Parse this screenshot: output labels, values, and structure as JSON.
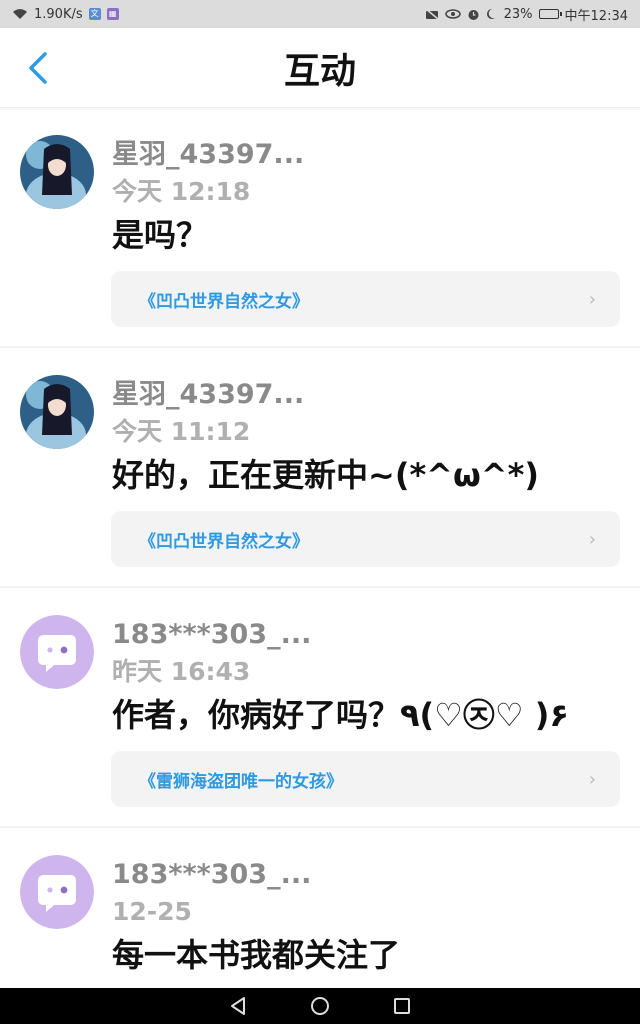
{
  "status_bar": {
    "speed": "1.90K/s",
    "battery": "23%",
    "battery_level": 0.23,
    "time": "中午12:34",
    "icons": [
      "wifi-icon",
      "translate-icon",
      "app-icon",
      "no-camera-icon",
      "eye-icon",
      "alarm-icon",
      "moon-icon",
      "battery-icon"
    ]
  },
  "header": {
    "title": "互动",
    "back_icon": "chevron-left-icon",
    "accent": "#2e9ae0"
  },
  "items": [
    {
      "username": "星羽_43397...",
      "time": "今天 12:18",
      "message": "是吗？",
      "book": "《凹凸世界自然之女》",
      "avatar": "anime-character-avatar"
    },
    {
      "username": "星羽_43397...",
      "time": "今天 11:12",
      "message": "好的，正在更新中~(*^ω^*)",
      "book": "《凹凸世界自然之女》",
      "avatar": "anime-character-avatar"
    },
    {
      "username": "183***303_...",
      "time": "昨天 16:43",
      "message": "作者，你病好了吗？٩(♡㉨♡ )۶",
      "book": "《雷狮海盗团唯一的女孩》",
      "avatar": "default-chat-avatar"
    },
    {
      "username": "183***303_...",
      "time": "12-25",
      "message": "每一本书我都关注了",
      "book": "",
      "avatar": "default-chat-avatar"
    }
  ],
  "nav_bar": {
    "icons": [
      "back-triangle-icon",
      "home-circle-icon",
      "recents-square-icon"
    ]
  }
}
